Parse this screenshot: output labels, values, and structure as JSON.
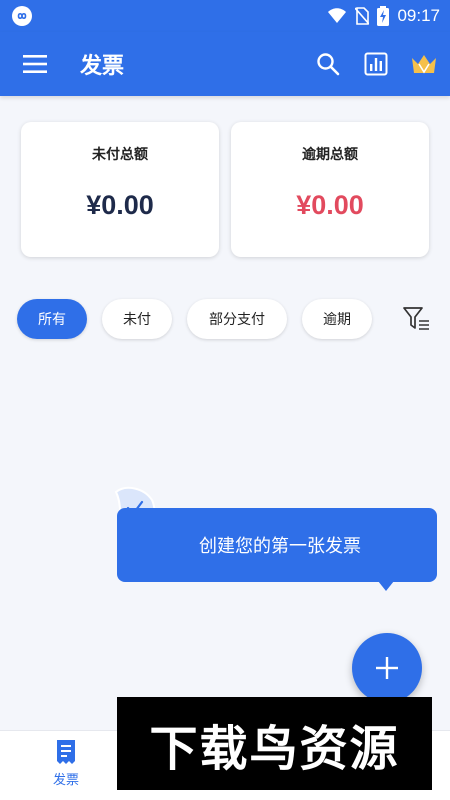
{
  "status_bar": {
    "time": "09:17"
  },
  "app_bar": {
    "title": "发票",
    "icons": [
      "menu-icon",
      "search-icon",
      "report-chart-icon",
      "crown-icon"
    ]
  },
  "summary": {
    "unpaid": {
      "title": "未付总额",
      "amount": "¥0.00",
      "color": "#1e2a4a"
    },
    "overdue": {
      "title": "逾期总额",
      "amount": "¥0.00",
      "color": "#e24a5e"
    }
  },
  "filters": {
    "chips": [
      "所有",
      "未付",
      "部分支付",
      "逾期"
    ],
    "active": "所有"
  },
  "empty_state": {
    "tooltip": "创建您的第一张发票"
  },
  "bottom_nav": {
    "invoice_label": "发票"
  },
  "watermark": {
    "text": "下载鸟资源"
  },
  "colors": {
    "primary": "#2f6fe8",
    "overdue": "#e24a5e",
    "background": "#f4f6fb"
  }
}
